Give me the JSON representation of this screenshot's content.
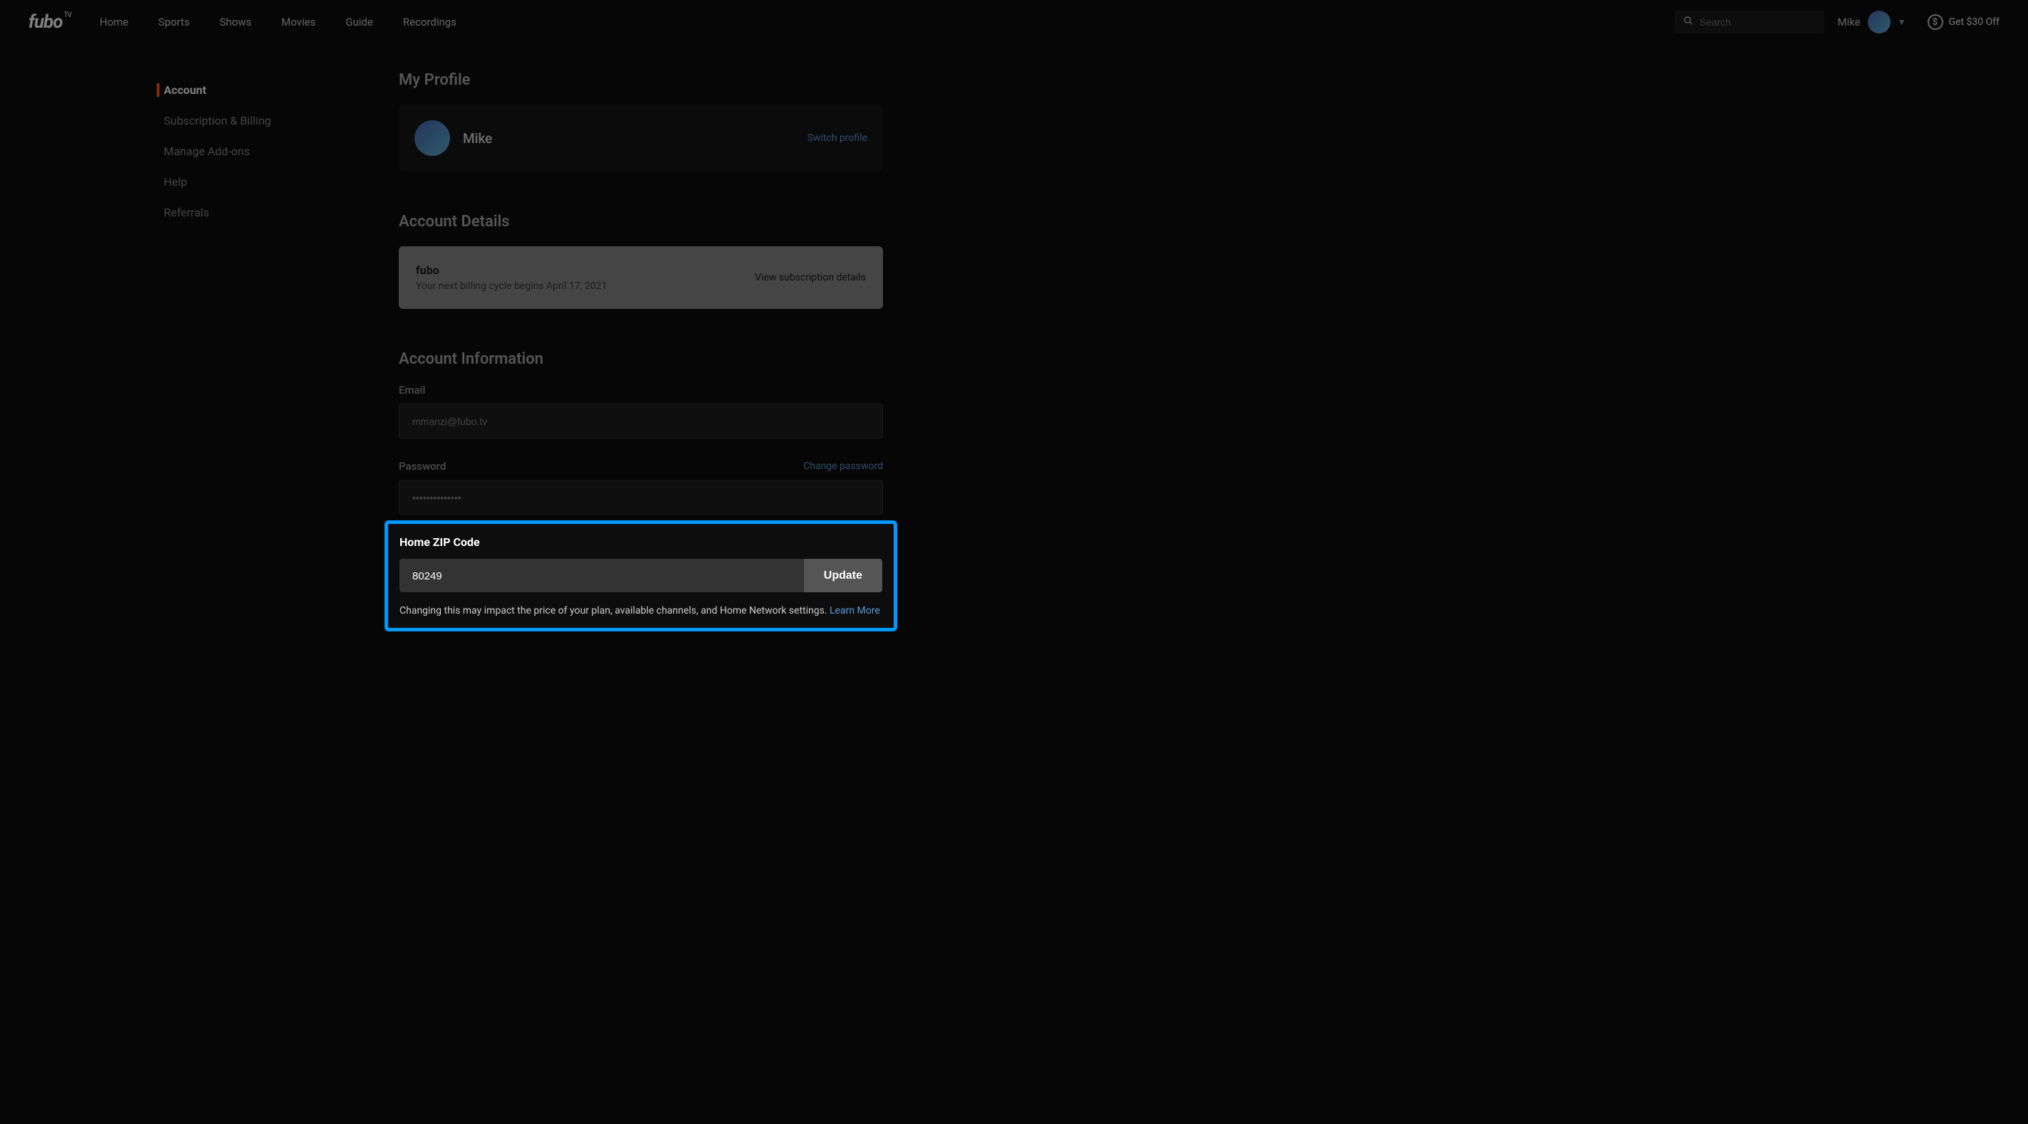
{
  "header": {
    "logo": "fubo",
    "logo_suffix": "TV",
    "nav": [
      {
        "label": "Home"
      },
      {
        "label": "Sports"
      },
      {
        "label": "Shows"
      },
      {
        "label": "Movies"
      },
      {
        "label": "Guide"
      },
      {
        "label": "Recordings"
      }
    ],
    "search_placeholder": "Search",
    "user_name": "Mike",
    "promo_label": "Get $30 Off"
  },
  "sidebar": {
    "items": [
      {
        "label": "Account",
        "active": true
      },
      {
        "label": "Subscription & Billing",
        "active": false
      },
      {
        "label": "Manage Add-ons",
        "active": false
      },
      {
        "label": "Help",
        "active": false
      },
      {
        "label": "Referrals",
        "active": false
      }
    ]
  },
  "profile": {
    "section_title": "My Profile",
    "name": "Mike",
    "switch_label": "Switch profile"
  },
  "account_details": {
    "section_title": "Account Details",
    "plan_name": "fubo",
    "billing_info": "Your next billing cycle begins April 17, 2021",
    "view_link": "View subscription details"
  },
  "account_info": {
    "section_title": "Account Information",
    "email_label": "Email",
    "email_value": "mmanzi@fubo.tv",
    "password_label": "Password",
    "password_value": "••••••••••••••",
    "change_password_label": "Change password",
    "zip_label": "Home ZIP Code",
    "zip_value": "80249",
    "update_label": "Update",
    "disclaimer": "Changing this may impact the price of your plan, available channels, and Home Network settings. ",
    "learn_more": "Learn More"
  }
}
